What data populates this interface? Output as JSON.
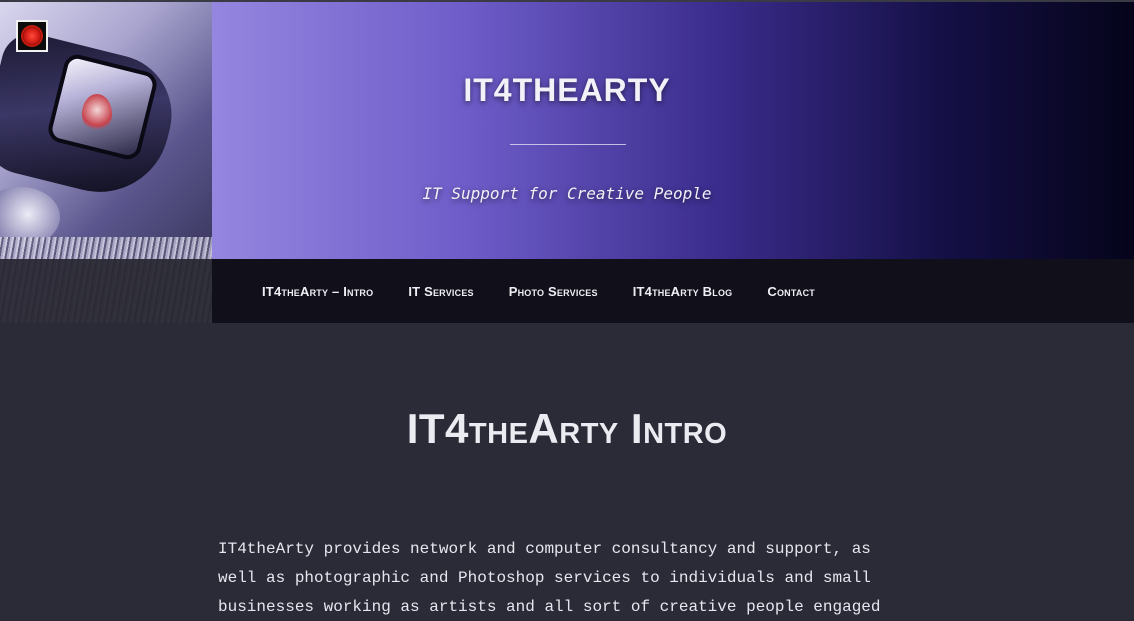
{
  "site": {
    "title": "IT4THEARTY",
    "tagline": "IT Support for Creative People"
  },
  "nav": {
    "items": [
      {
        "label": "IT4theArty – Intro"
      },
      {
        "label": "IT Services"
      },
      {
        "label": "Photo Services"
      },
      {
        "label": "IT4theArty Blog"
      },
      {
        "label": "Contact"
      }
    ]
  },
  "main": {
    "page_title": "IT4theArty Intro",
    "intro_text": "IT4theArty provides network and computer consultancy and support, as well as photographic and Photoshop services to individuals and small businesses working as artists and all sort of creative people engaged"
  },
  "icons": {
    "logo": "sun-logo-icon"
  },
  "colors": {
    "banner_start": "#9586e0",
    "banner_end": "#05041a",
    "background": "#2a2b36",
    "logo_red": "#d21b14"
  }
}
